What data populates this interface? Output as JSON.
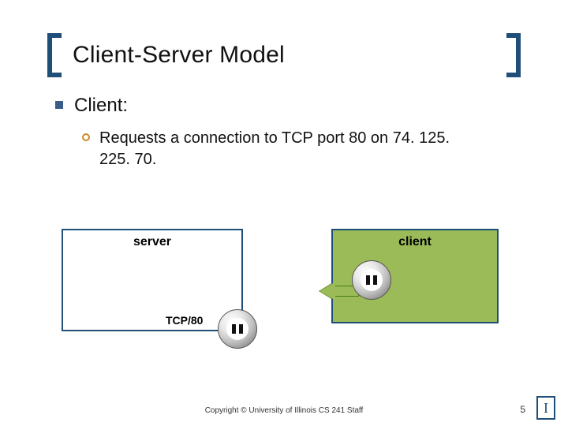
{
  "title": "Client-Server Model",
  "bullet1": "Client:",
  "bullet2": "Requests a connection to TCP port 80 on 74. 125. 225. 70.",
  "diagram": {
    "server_label": "server",
    "client_label": "client",
    "port_label": "TCP/80"
  },
  "footer": "Copyright © University of Illinois CS 241 Staff",
  "page_number": "5",
  "logo_text": "I"
}
